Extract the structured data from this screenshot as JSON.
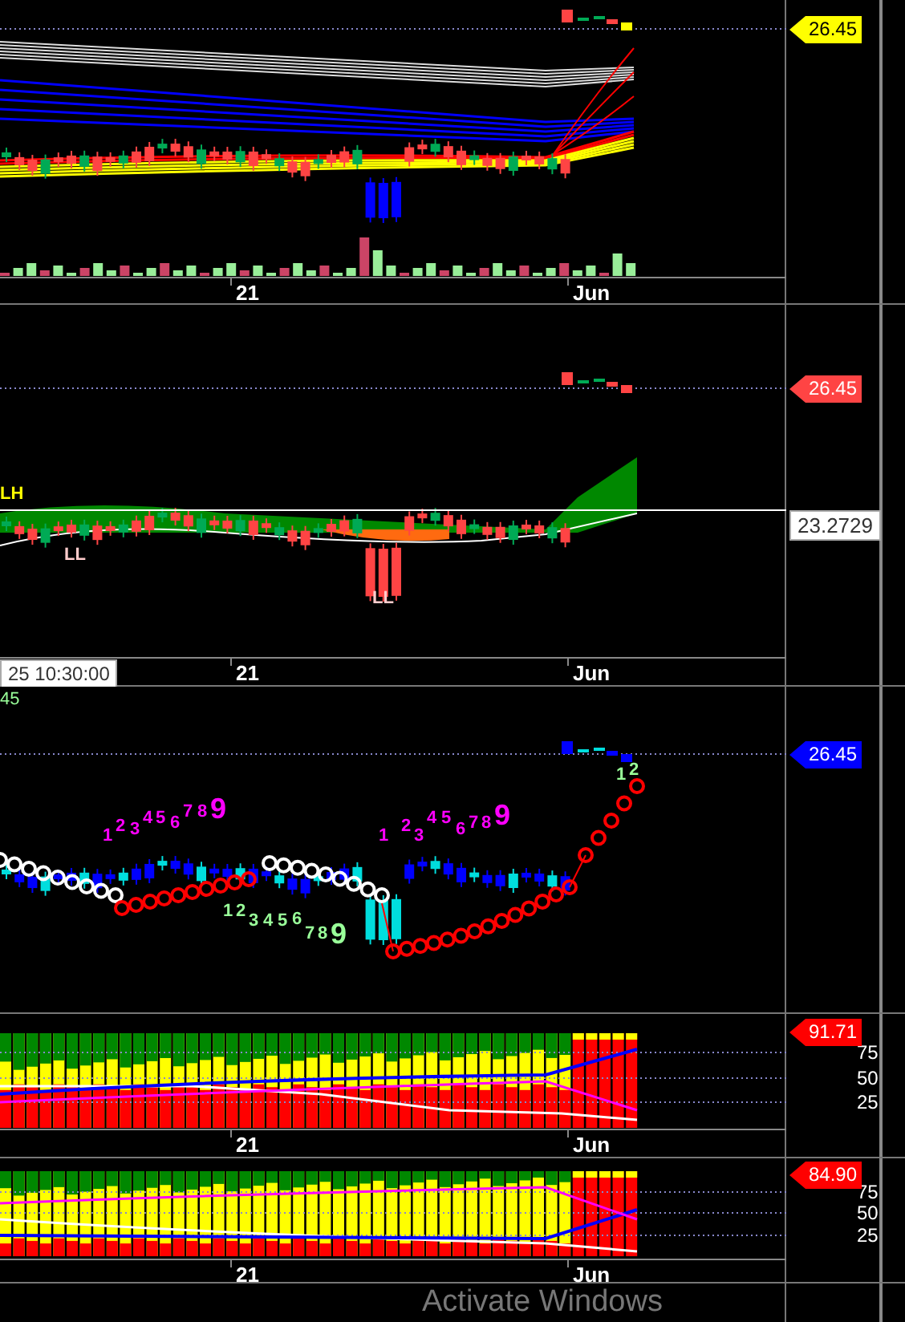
{
  "panes": [
    {
      "kind": "price",
      "price_tag": {
        "text": "26.45",
        "color": "#ffff00"
      },
      "x_axis": [
        "21",
        "Jun"
      ]
    },
    {
      "kind": "cloud",
      "price_tag": {
        "text": "26.45",
        "color": "#ff4444"
      },
      "crosshair_value": "23.2729",
      "crosshair_time": "25 10:30:00",
      "pivot_labels": [
        "LH",
        "LL",
        "LL"
      ],
      "x_axis": [
        "21",
        "Jun"
      ]
    },
    {
      "kind": "sequential",
      "corner_value": "45",
      "price_tag": {
        "text": "26.45",
        "color": "#0000ff"
      },
      "counts": [
        {
          "color": "#ff00ff",
          "digits": [
            "1",
            "2",
            "3",
            "4",
            "5",
            "6",
            "7",
            "8",
            "9"
          ]
        },
        {
          "color": "#99ff99",
          "digits": [
            "1",
            "2",
            "3",
            "4",
            "5",
            "6",
            "7",
            "8",
            "9"
          ]
        },
        {
          "color": "#ff00ff",
          "digits": [
            "1",
            "2",
            "3",
            "4",
            "5",
            "6",
            "7",
            "8",
            "9"
          ]
        },
        {
          "color": "#99ff99",
          "digits": [
            "1",
            "2"
          ]
        }
      ]
    },
    {
      "kind": "stochastic",
      "price_tag": {
        "text": "91.71",
        "color": "#ff0000"
      },
      "y_ticks": [
        "75",
        "50",
        "25"
      ],
      "x_axis": [
        "21",
        "Jun"
      ]
    },
    {
      "kind": "stochastic",
      "price_tag": {
        "text": "84.90",
        "color": "#ff0000"
      },
      "y_ticks": [
        "75",
        "50",
        "25"
      ],
      "x_axis": [
        "21",
        "Jun"
      ]
    }
  ],
  "overlay_text": "Activate Windows"
}
